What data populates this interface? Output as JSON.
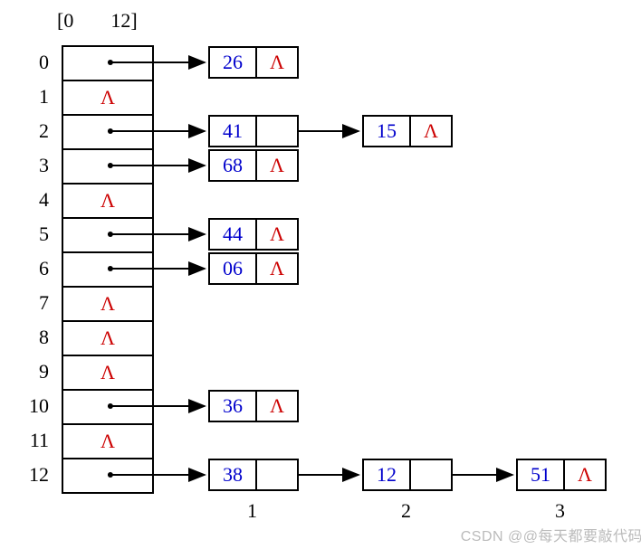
{
  "header": {
    "open": "[0",
    "close": "12]"
  },
  "table_size": 13,
  "lambda_glyph": "Λ",
  "slots": [
    {
      "index": "0",
      "null": false,
      "chain": [
        {
          "value": "26",
          "null": true
        }
      ]
    },
    {
      "index": "1",
      "null": true,
      "chain": []
    },
    {
      "index": "2",
      "null": false,
      "chain": [
        {
          "value": "41",
          "null": false
        },
        {
          "value": "15",
          "null": true
        }
      ]
    },
    {
      "index": "3",
      "null": false,
      "chain": [
        {
          "value": "68",
          "null": true
        }
      ]
    },
    {
      "index": "4",
      "null": true,
      "chain": []
    },
    {
      "index": "5",
      "null": false,
      "chain": [
        {
          "value": "44",
          "null": true
        }
      ]
    },
    {
      "index": "6",
      "null": false,
      "chain": [
        {
          "value": "06",
          "null": true
        }
      ]
    },
    {
      "index": "7",
      "null": true,
      "chain": []
    },
    {
      "index": "8",
      "null": true,
      "chain": []
    },
    {
      "index": "9",
      "null": true,
      "chain": []
    },
    {
      "index": "10",
      "null": false,
      "chain": [
        {
          "value": "36",
          "null": true
        }
      ]
    },
    {
      "index": "11",
      "null": true,
      "chain": []
    },
    {
      "index": "12",
      "null": false,
      "chain": [
        {
          "value": "38",
          "null": false
        },
        {
          "value": "12",
          "null": false
        },
        {
          "value": "51",
          "null": true
        }
      ]
    }
  ],
  "bottom_labels": [
    "1",
    "2",
    "3"
  ],
  "watermark": "CSDN @@每天都要敲代码",
  "chart_data": {
    "type": "table",
    "title": "Hash table with separate chaining, size 13",
    "buckets": 13,
    "chains": {
      "0": [
        26
      ],
      "1": [],
      "2": [
        41,
        15
      ],
      "3": [
        68
      ],
      "4": [],
      "5": [
        44
      ],
      "6": [
        6
      ],
      "7": [],
      "8": [],
      "9": [],
      "10": [
        36
      ],
      "11": [],
      "12": [
        38,
        12,
        51
      ]
    },
    "max_chain_length_labels": [
      1,
      2,
      3
    ]
  }
}
